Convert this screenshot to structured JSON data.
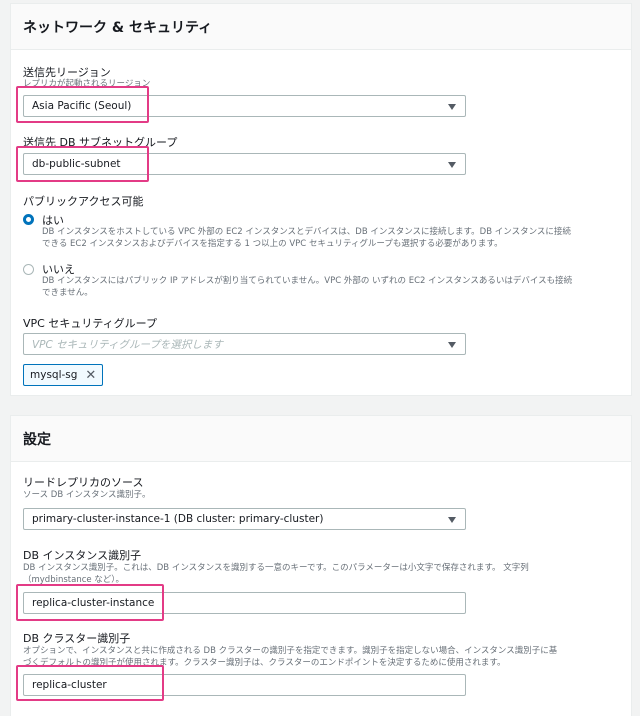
{
  "network": {
    "title": "ネットワーク & セキュリティ",
    "region": {
      "label": "送信先リージョン",
      "description": "レプリカが起動されるリージョン",
      "value": "Asia Pacific (Seoul)"
    },
    "subnet": {
      "label": "送信先 DB サブネットグループ",
      "value": "db-public-subnet"
    },
    "public_access": {
      "label": "パブリックアクセス可能",
      "yes_label": "はい",
      "yes_desc_1": "DB インスタンスをホストしている VPC 外部の EC2 インスタンスとデバイスは、DB インスタンスに接続します。DB インスタンスに接続",
      "yes_desc_2": "できる EC2 インスタンスおよびデバイスを指定する 1 つ以上の VPC セキュリティグループも選択する必要があります。",
      "no_label": "いいえ",
      "no_desc_1": "DB インスタンスにはパブリック IP アドレスが割り当てられていません。VPC 外部の いずれの EC2 インスタンスあるいはデバイスも接続",
      "no_desc_2": "できません。",
      "selected": "はい"
    },
    "vpc_sg": {
      "label": "VPC セキュリティグループ",
      "placeholder": "VPC セキュリティグループを選択します",
      "token": "mysql-sg"
    }
  },
  "settings": {
    "title": "設定",
    "source": {
      "label": "リードレプリカのソース",
      "description": "ソース DB インスタンス識別子。",
      "value": "primary-cluster-instance-1 (DB cluster: primary-cluster)"
    },
    "instance_id": {
      "label": "DB インスタンス識別子",
      "desc_1": "DB インスタンス識別子。これは、DB インスタンスを識別する一意のキーです。このパラメーターは小文字で保存されます。 文字列",
      "desc_2": "（mydbinstance など）。",
      "value": "replica-cluster-instance"
    },
    "cluster_id": {
      "label": "DB クラスター識別子",
      "desc_1": "オプションで、インスタンスと共に作成される DB クラスターの識別子を指定できます。識別子を指定しない場合、インスタンス識別子に基",
      "desc_2": "づくデフォルトの識別子が使用されます。クラスター識別子は、クラスターのエンドポイントを決定するために使用されます。",
      "value": "replica-cluster"
    }
  },
  "colors": {
    "highlight": "#e33b86",
    "radio_selected": "#0073bb",
    "token_border": "#0073bb"
  }
}
